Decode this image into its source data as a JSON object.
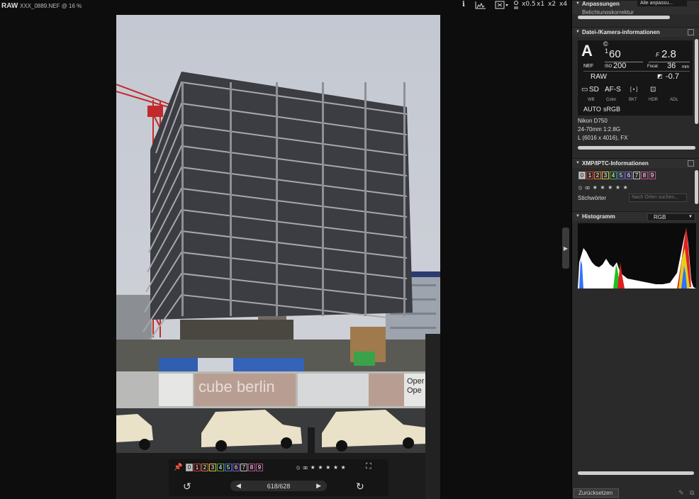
{
  "topbar": {
    "format": "RAW",
    "filename": "XXX_0889.NEF @ 16 %",
    "icons": [
      "info-icon",
      "histogram-icon",
      "crop-icon"
    ],
    "zoom_options": [
      "x0.5",
      "x1",
      "x2",
      "x4"
    ]
  },
  "overlay": {
    "labels": [
      "0",
      "1",
      "2",
      "3",
      "4",
      "5",
      "6",
      "7",
      "8",
      "9"
    ],
    "label_colors": [
      "#9a9a9a",
      "#d23c3c",
      "#d67a2c",
      "#d8c33a",
      "#4aa84a",
      "#3a7ad0",
      "#8a5ac8",
      "#c0c0c0",
      "#c04a8a",
      "#c04a8a"
    ],
    "rating": "⦸ ⌧ ★ ★ ★ ★ ★",
    "counter": "618/628"
  },
  "panel": {
    "adjustments": {
      "title": "Anpassungen",
      "select": "Alle anpassu...",
      "sub": "Belichtungskorrektur"
    },
    "camera_section": {
      "title": "Datei-/Kamera-informationen",
      "mode": "A",
      "copyright": "©",
      "shutter_num": "1",
      "shutter_den": "60",
      "aperture_prefix": "F",
      "aperture": "2.8",
      "file_type": "NEF",
      "iso_label": "ISO",
      "iso": "200",
      "focal_label": "Focal",
      "focal": "36",
      "focal_unit": "mm",
      "quality": "RAW",
      "exposure_comp": "-0.7",
      "media": "SD",
      "focus": "AF-S",
      "bkt_icon": "[ ▪ ]",
      "wb_label": "WB",
      "color_label": "Color",
      "bkt_label": "BKT",
      "hdr_label": "HDR",
      "adl_label": "ADL",
      "wb": "AUTO",
      "color_space": "sRGB",
      "camera": "Nikon D750",
      "lens": "24-70mm 1:2.8G",
      "size": "L (6016 x 4016), FX"
    },
    "xmp_section": {
      "title": "XMP/IPTC-Informationen",
      "labels": [
        "0",
        "1",
        "2",
        "3",
        "4",
        "5",
        "6",
        "7",
        "8",
        "9"
      ],
      "rating": "⦸ ⌧ ★ ★ ★ ★ ★",
      "keywords_label": "Stichwörter",
      "keywords_placeholder": "Nach Orten suchen..."
    },
    "histogram_section": {
      "title": "Histogramm",
      "channel": "RGB"
    },
    "reset_label": "Zurücksetzen"
  },
  "photo": {
    "sign_text": "cube berlin",
    "sign_text2": "Oper",
    "sign_text3": "Ope"
  }
}
